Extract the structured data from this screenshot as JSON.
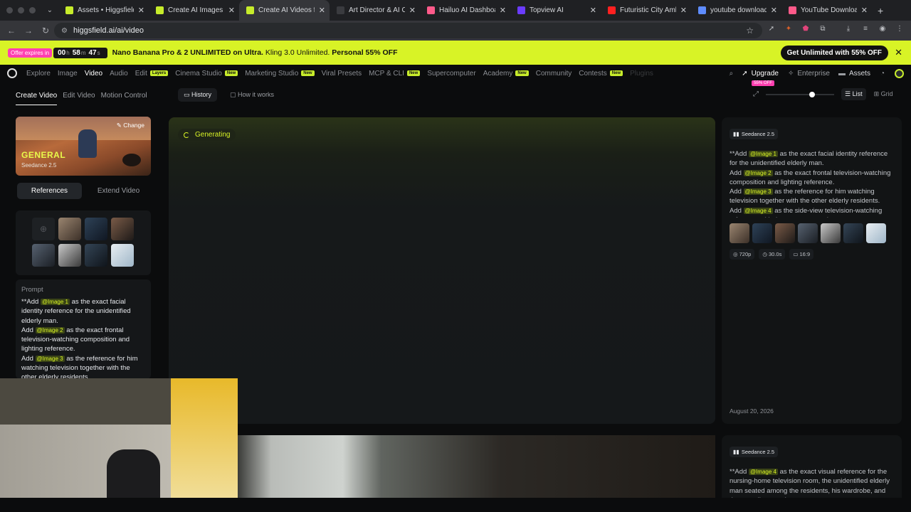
{
  "browser": {
    "tabs": [
      {
        "title": "Assets • Higgsfield",
        "favicon_color": "#c7ec2b",
        "active": false
      },
      {
        "title": "Create AI Images from Text",
        "favicon_color": "#c7ec2b",
        "active": false
      },
      {
        "title": "Create AI Videos from Text",
        "favicon_color": "#c7ec2b",
        "active": true
      },
      {
        "title": "Art Director & AI Creative",
        "favicon_color": "#3a3b3f",
        "active": false
      },
      {
        "title": "Hailuo AI Dashboard",
        "favicon_color": "#ff5a8a",
        "active": false
      },
      {
        "title": "Topview AI",
        "favicon_color": "#6b3cff",
        "active": false
      },
      {
        "title": "Futuristic City Ambience",
        "favicon_color": "#ff2020",
        "active": false
      },
      {
        "title": "youtube download online",
        "favicon_color": "#5e8cff",
        "active": false
      },
      {
        "title": "YouTube Downloader",
        "favicon_color": "#ff5a8a",
        "active": false
      }
    ],
    "url": "higgsfield.ai/ai/video"
  },
  "promo": {
    "offer_label": "Offer expires in",
    "hours": "00",
    "minutes": "58",
    "seconds": "47",
    "unit_h": "h",
    "unit_m": "m",
    "unit_s": "s",
    "headline": "Nano Banana Pro & 2 UNLIMITED on Ultra.",
    "detail": "Kling 3.0 Unlimited.",
    "personal": "Personal 55% OFF",
    "cta": "Get Unlimited with 55% OFF"
  },
  "nav": {
    "items": [
      {
        "label": "Explore"
      },
      {
        "label": "Image"
      },
      {
        "label": "Video",
        "active": true
      },
      {
        "label": "Audio"
      },
      {
        "label": "Edit",
        "badge": "Layers"
      },
      {
        "label": "Cinema Studio",
        "badge": "New"
      },
      {
        "label": "Marketing Studio",
        "badge": "New"
      },
      {
        "label": "Viral Presets"
      },
      {
        "label": "MCP & CLI",
        "badge": "New"
      },
      {
        "label": "Supercomputer"
      },
      {
        "label": "Academy",
        "badge": "New"
      },
      {
        "label": "Community"
      },
      {
        "label": "Contests",
        "badge": "New"
      },
      {
        "label": "Plugins"
      }
    ],
    "upgrade": "Upgrade",
    "upgrade_badge": "55% OFF",
    "enterprise": "Enterprise",
    "assets": "Assets"
  },
  "left": {
    "mode_tabs": [
      "Create Video",
      "Edit Video",
      "Motion Control"
    ],
    "model_name": "GENERAL",
    "model_version": "Seedance 2.5",
    "change_label": "Change",
    "ref_tabs": [
      "References",
      "Extend Video"
    ],
    "prompt_label": "Prompt",
    "prompt_lines": [
      {
        "pre": "**Add ",
        "mention": "@Image 1",
        "post": " as the exact facial identity reference for the unidentified elderly man."
      },
      {
        "pre": "Add ",
        "mention": "@Image 2",
        "post": " as the exact frontal television-watching composition and lighting reference."
      },
      {
        "pre": "Add ",
        "mention": "@Image 3",
        "post": " as the reference for him watching television together with the other elderly residents."
      }
    ]
  },
  "main": {
    "history_tab": "History",
    "how_tab": "How it works",
    "status": "Generating",
    "list_label": "List",
    "grid_label": "Grid",
    "zoom_level": 0.68
  },
  "detail": {
    "model": "Seedance 2.5",
    "prompt_lines": [
      {
        "pre": "**Add ",
        "mention": "@Image 1",
        "post": " as the exact facial identity reference for the unidentified elderly man."
      },
      {
        "pre": "Add ",
        "mention": "@Image 2",
        "post": " as the exact frontal television-watching composition and lighting reference."
      },
      {
        "pre": "Add ",
        "mention": "@Image 3",
        "post": " as the reference for him watching television together with the other elderly residents."
      },
      {
        "pre": "Add ",
        "mention": "@Image 4",
        "post": " as the side-view television-watching reference with the remote control."
      }
    ],
    "resolution": "720p",
    "duration": "30.0s",
    "aspect": "16:9",
    "date": "August 20, 2026",
    "second_model": "Seedance 2.5",
    "second_prompt": {
      "pre": "**Add ",
      "mention": "@Image 4",
      "post": " as the exact visual reference for the nursing-home television room, the unidentified elderly man seated among the residents, his wardrobe, and the overall atmosphere."
    }
  }
}
